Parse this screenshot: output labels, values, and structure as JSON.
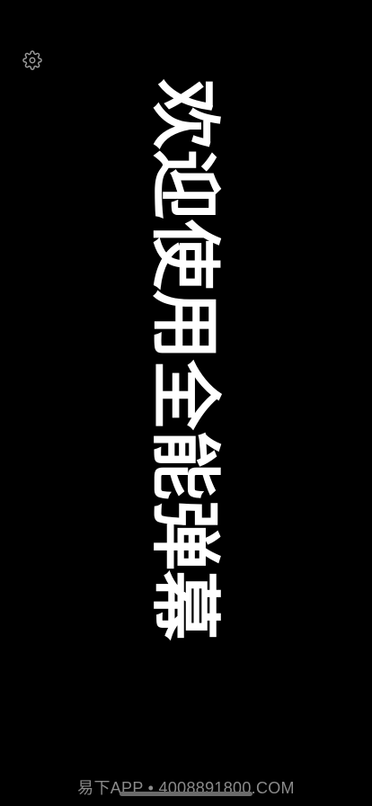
{
  "settings": {
    "icon": "gear-icon"
  },
  "danmaku": {
    "text": "欢迎使用全能弹幕",
    "color": "#ffffff",
    "background": "#000000"
  },
  "watermark": {
    "text": "易下APP • 4008891800.COM"
  }
}
